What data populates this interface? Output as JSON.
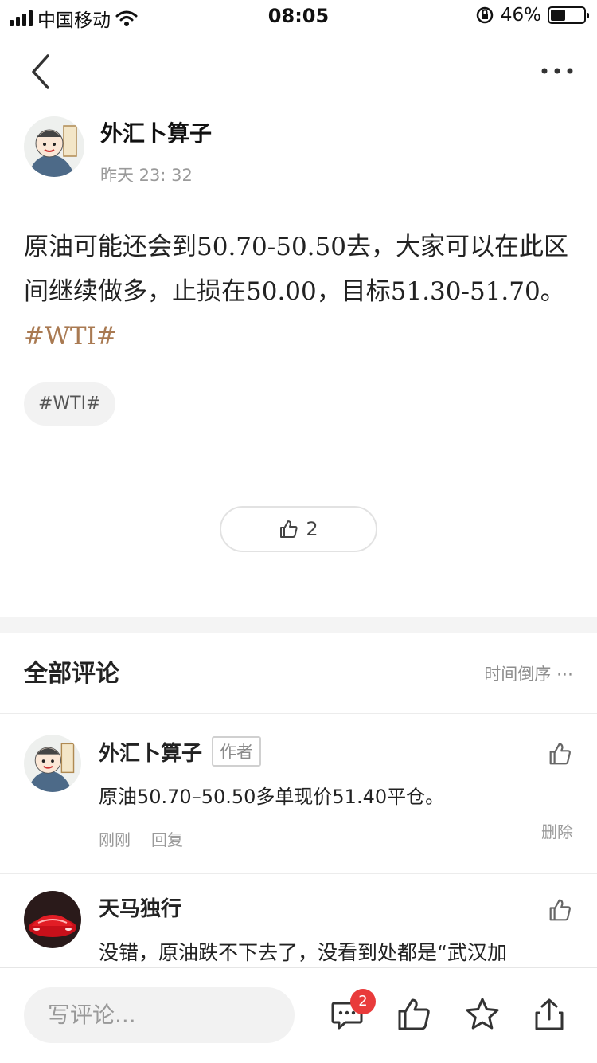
{
  "status_bar": {
    "carrier": "中国移动",
    "time": "08:05",
    "battery": "46%",
    "battery_level": 0.46
  },
  "nav": {
    "back_icon": "chevron-left-icon",
    "more_icon": "more-horizontal-icon"
  },
  "post": {
    "author_name": "外汇卜算子",
    "time": "昨天 23: 32",
    "body_text": "原油可能还会到50.70-50.50去，大家可以在此区间继续做多，止损在50.00，目标51.30-51.70。",
    "topic_link": "#WTI#",
    "tag": "#WTI#",
    "like_count": "2"
  },
  "comments_section": {
    "title": "全部评论",
    "sort_label": "时间倒序 ⋯"
  },
  "comments": [
    {
      "name": "外汇卜算子",
      "badge": "作者",
      "text": "原油50.70–50.50多单现价51.40平仓。",
      "time": "刚刚",
      "reply": "回复",
      "delete": "删除"
    },
    {
      "name": "天马独行",
      "text": "没错，原油跌不下去了，没看到处都是“武汉加"
    }
  ],
  "bottom_bar": {
    "input_placeholder": "写评论...",
    "comment_count": "2"
  },
  "colors": {
    "topic": "#a97a52",
    "badge_red": "#e93b3b"
  }
}
